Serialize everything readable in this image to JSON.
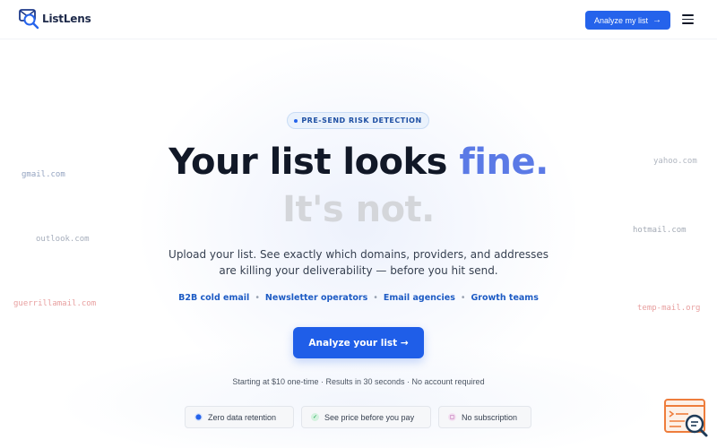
{
  "header": {
    "brand": "ListLens",
    "cta_label": "Analyze my list",
    "cta_arrow": "→"
  },
  "floating_domains": {
    "left": [
      "gmail.com",
      "outlook.com",
      "guerrillamail.com"
    ],
    "right": [
      "yahoo.com",
      "hotmail.com",
      "temp-mail.org"
    ]
  },
  "hero": {
    "badge": "PRE-SEND RISK DETECTION",
    "headline_main": "Your list looks ",
    "headline_accent": "fine.",
    "headline_sub": "It's not.",
    "subtitle": "Upload your list. See exactly which domains, providers, and addresses are killing your deliverability — before you hit send.",
    "audiences": [
      "B2B cold email",
      "Newsletter operators",
      "Email agencies",
      "Growth teams"
    ],
    "cta_label": "Analyze your list →",
    "fine_print": "Starting at $10 one-time · Results in 30 seconds · No account required"
  },
  "chips": [
    {
      "icon": "shield-icon",
      "label": "Zero data retention"
    },
    {
      "icon": "check-icon",
      "label": "See price before you pay"
    },
    {
      "icon": "lock-icon",
      "label": "No subscription"
    }
  ],
  "colors": {
    "primary": "#2563eb",
    "accent": "#5b7ae6",
    "heading": "#111827",
    "muted_heading": "#d4d6da",
    "risk_domain": "#e8a0a0",
    "widget_orange": "#ee7d3c"
  }
}
